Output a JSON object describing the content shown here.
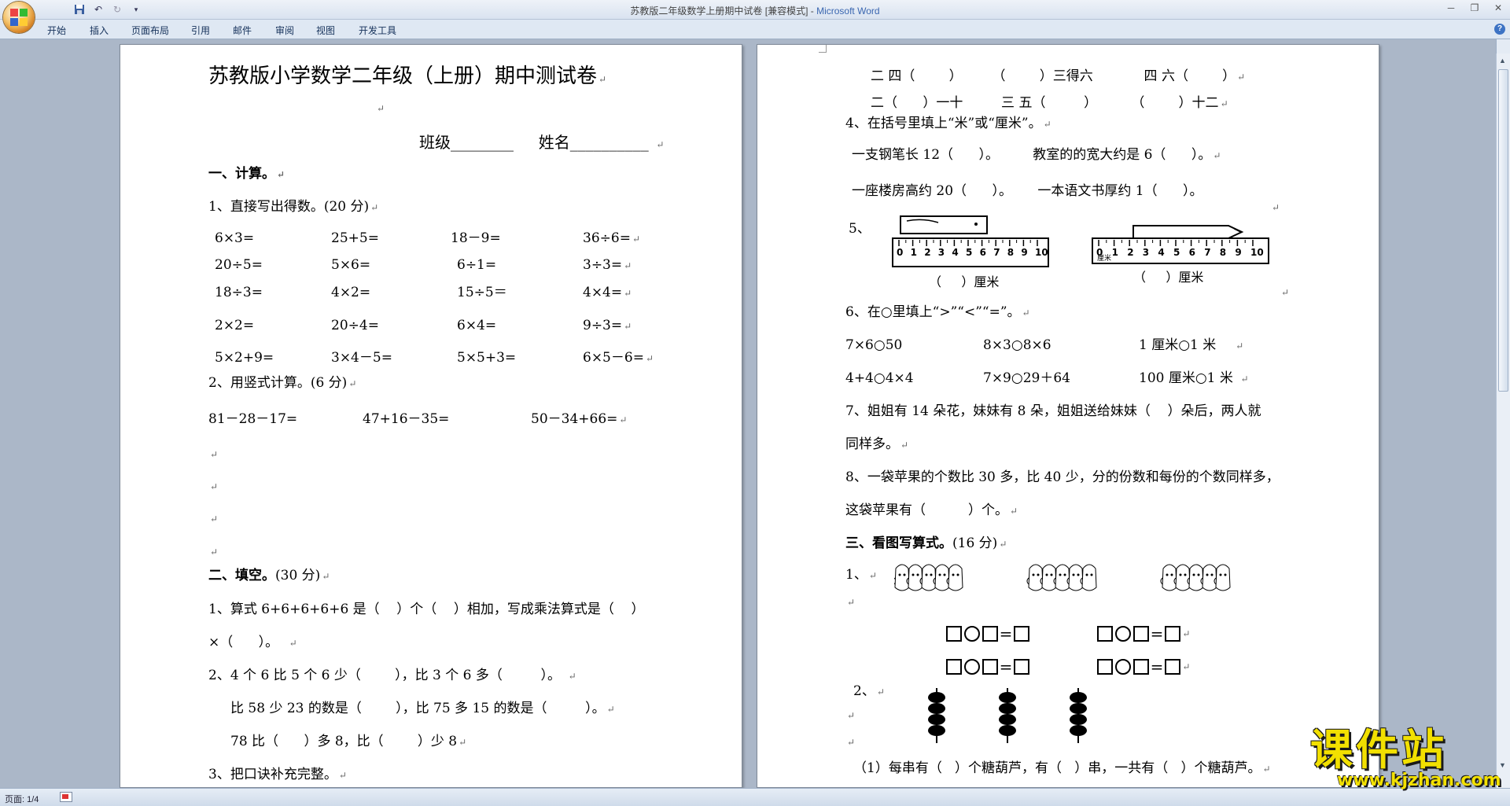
{
  "window": {
    "title": "苏教版二年级数学上册期中试卷 [兼容模式] - ",
    "app": "Microsoft Word"
  },
  "ribbon": {
    "tabs": [
      "开始",
      "插入",
      "页面布局",
      "引用",
      "邮件",
      "审阅",
      "视图",
      "开发工具"
    ]
  },
  "status": {
    "page": "页面: 1/4"
  },
  "watermark": {
    "big": "课件站",
    "small": "www.kjzhan.com"
  },
  "page1": {
    "title": "苏教版小学数学二年级（上册）期中测试卷",
    "class_line": "班级________     姓名__________",
    "s1": "一、计算。",
    "s1_q1": "1、直接写出得数。(20 分)",
    "calc_rows": [
      [
        "6×3=",
        "25+5=",
        "18－9=",
        "36÷6="
      ],
      [
        "20÷5=",
        "5×6=",
        "6÷1=",
        "3÷3="
      ],
      [
        "18÷3=",
        "4×2=",
        "15÷5＝",
        "4×4="
      ],
      [
        "2×2=",
        "20÷4=",
        "6×4=",
        "9÷3="
      ],
      [
        "5×2+9=",
        "3×4－5=",
        "5×5+3=",
        "6×5－6="
      ]
    ],
    "s1_q2": "2、用竖式计算。(6 分)",
    "vert": [
      "81－28－17=",
      "47+16－35=",
      "50－34+66="
    ],
    "s2": "二、填空。",
    "s2_pts": "(30 分)",
    "fill1a": "1、算式 6+6+6+6+6 是（    ）个（    ）相加，写成乘法算式是（    ）",
    "fill1b": "×（      ）。",
    "fill2a": "2、4 个 6 比 5 个 6 少（        ），比 3 个 6 多（         ）。",
    "fill2b": "比 58 少 23 的数是（        ），比 75 多 15 的数是（         ）。",
    "fill2c": "78 比（      ）多 8，比（        ）少 8",
    "fill3": "3、把口诀补充完整。"
  },
  "page2": {
    "kj1": "二 四（        ）       （        ）三得六            四 六（        ）",
    "kj2": "二（      ）一十         三 五（         ）        （        ）十二",
    "q4": "4、在括号里填上“米”或“厘米”。",
    "q4a": "一支钢笔长 12（      ）。        教室的的宽大约是 6（      ）。",
    "q4b": "一座楼房高约 20（      ）。      一本语文书厚约 1（      ）。",
    "q5": "5、",
    "ruler1_ans": "（     ）厘米",
    "ruler2_ans": "（     ）厘米",
    "ruler2_unit": "厘米",
    "ruler_nums": [
      "0",
      "1",
      "2",
      "3",
      "4",
      "5",
      "6",
      "7",
      "8",
      "9",
      "10"
    ],
    "q6": "6、在○里填上“>”“<”“=”。",
    "cmp": [
      [
        "7×6○50",
        "8×3○8×6",
        "1 厘米○1 米"
      ],
      [
        "4+4○4×4",
        "7×9○29＋64",
        "100 厘米○1 米"
      ]
    ],
    "q7a": "7、姐姐有 14 朵花，妹妹有 8 朵，姐姐送给妹妹（    ）朵后，两人就",
    "q7b": "同样多。",
    "q8a": "8、一袋苹果的个数比 30 多，比 40 少，分的份数和每份的个数同样多，",
    "q8b": "这袋苹果有（          ）个。",
    "s3": "三、看图写算式。",
    "s3_pts": "(16 分)",
    "p1": "1、",
    "p2": "2、",
    "p2q": "（1）每串有（   ）个糖葫芦，有（   ）串，一共有（   ）个糖葫芦。"
  },
  "colors": {
    "page_bg": "#ffffff",
    "workspace": "#abb7c8",
    "watermark": "#f2e000"
  }
}
